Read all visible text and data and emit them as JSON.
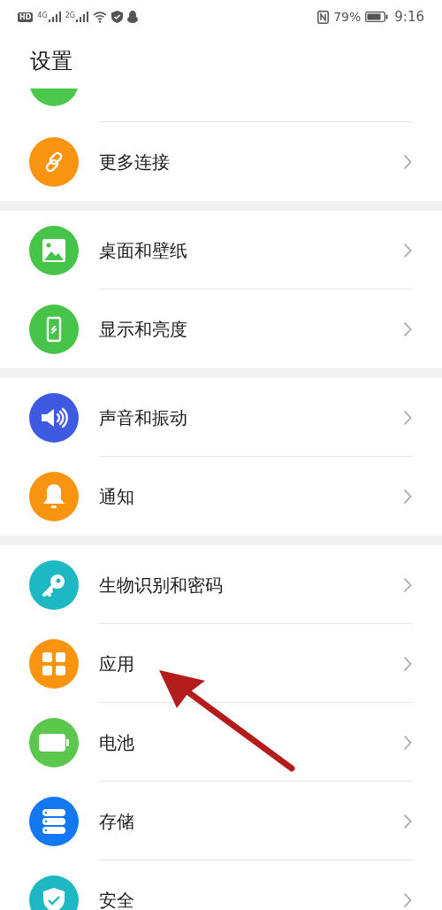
{
  "status_bar": {
    "hd": "HD",
    "signals": [
      "4G",
      "2G"
    ],
    "battery_percent": "79%",
    "time": "9:16"
  },
  "title": "设置",
  "peek": {
    "color": "#4cc94c"
  },
  "groups": [
    [
      {
        "label": "更多连接",
        "kind": "link",
        "color": "#f8940f"
      }
    ],
    [
      {
        "label": "桌面和壁纸",
        "kind": "image",
        "color": "#46c449"
      },
      {
        "label": "显示和亮度",
        "kind": "phone",
        "color": "#46c449"
      }
    ],
    [
      {
        "label": "声音和振动",
        "kind": "sound",
        "color": "#3e5ae0"
      },
      {
        "label": "通知",
        "kind": "bell",
        "color": "#f8940f"
      }
    ],
    [
      {
        "label": "生物识别和密码",
        "kind": "key",
        "color": "#1eb8c2"
      },
      {
        "label": "应用",
        "kind": "grid",
        "color": "#f8940f"
      },
      {
        "label": "电池",
        "kind": "battery",
        "color": "#5cc74d"
      },
      {
        "label": "存储",
        "kind": "storage",
        "color": "#1479f0"
      },
      {
        "label": "安全",
        "kind": "shield",
        "color": "#1eb8c2"
      }
    ]
  ]
}
